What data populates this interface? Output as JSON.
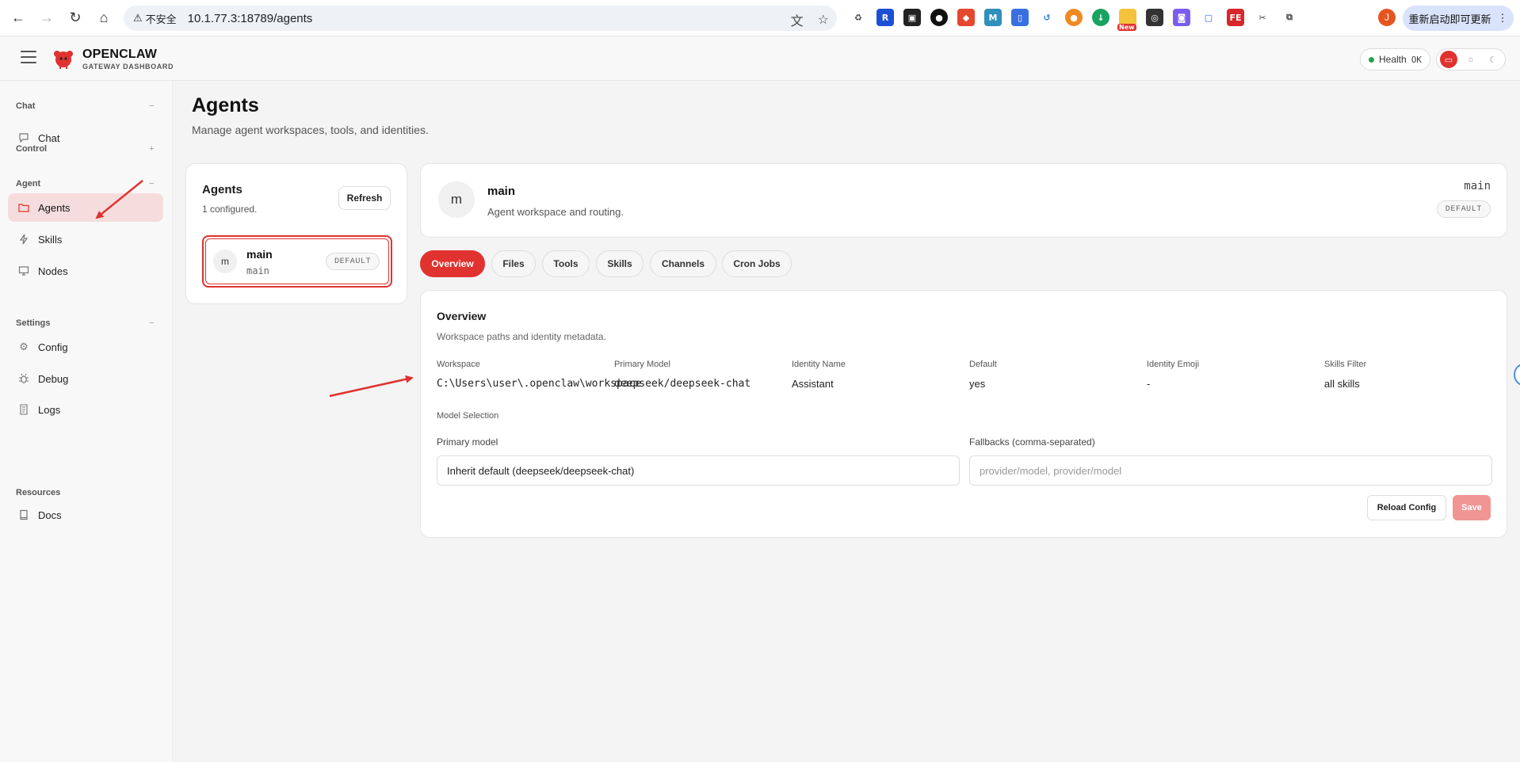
{
  "browser": {
    "insecure_label": "不安全",
    "url": "10.1.77.3:18789/agents",
    "extension_new_badge": "New",
    "profile_initial": "J",
    "update_button": "重新启动即可更新"
  },
  "header": {
    "brand": "OPENCLAW",
    "brand_sub": "GATEWAY DASHBOARD",
    "health_label": "Health",
    "health_value": "OK"
  },
  "sidebar": {
    "groups": [
      {
        "title": "Chat",
        "toggle": "−"
      },
      {
        "title": "Control",
        "toggle": "+"
      },
      {
        "title": "Agent",
        "toggle": "−"
      },
      {
        "title": "Settings",
        "toggle": "−"
      },
      {
        "title": "Resources",
        "toggle": ""
      }
    ],
    "items": [
      {
        "label": "Chat",
        "icon": "chat-bubble-icon"
      },
      {
        "label": "Agents",
        "icon": "folder-icon",
        "active": true
      },
      {
        "label": "Skills",
        "icon": "bolt-icon"
      },
      {
        "label": "Nodes",
        "icon": "monitor-icon"
      },
      {
        "label": "Config",
        "icon": "gear-icon"
      },
      {
        "label": "Debug",
        "icon": "bug-icon"
      },
      {
        "label": "Logs",
        "icon": "scroll-icon"
      },
      {
        "label": "Docs",
        "icon": "book-icon"
      }
    ]
  },
  "page": {
    "title": "Agents",
    "subtitle": "Manage agent workspaces, tools, and identities."
  },
  "agents_panel": {
    "title": "Agents",
    "count": "1 configured.",
    "refresh": "Refresh",
    "list": [
      {
        "initial": "m",
        "name": "main",
        "id": "main",
        "badge": "DEFAULT"
      }
    ]
  },
  "detail": {
    "initial": "m",
    "name": "main",
    "subtitle": "Agent workspace and routing.",
    "id": "main",
    "badge": "DEFAULT"
  },
  "tabs": [
    "Overview",
    "Files",
    "Tools",
    "Skills",
    "Channels",
    "Cron Jobs"
  ],
  "overview": {
    "title": "Overview",
    "subtitle": "Workspace paths and identity metadata.",
    "meta": [
      {
        "label": "Workspace",
        "value": "C:\\Users\\user\\.openclaw\\workspace"
      },
      {
        "label": "Primary Model",
        "value": "deepseek/deepseek-chat"
      },
      {
        "label": "Identity Name",
        "value": "Assistant"
      },
      {
        "label": "Default",
        "value": "yes"
      },
      {
        "label": "Identity Emoji",
        "value": "-"
      },
      {
        "label": "Skills Filter",
        "value": "all skills"
      }
    ],
    "model_selection_label": "Model Selection",
    "primary_model_label": "Primary model",
    "primary_model_value": "Inherit default (deepseek/deepseek-chat)",
    "fallbacks_label": "Fallbacks (comma-separated)",
    "fallbacks_placeholder": "provider/model, provider/model",
    "reload_button": "Reload Config",
    "save_button": "Save"
  },
  "colors": {
    "accent": "#e0322f",
    "active_nav_bg": "#f6dddd",
    "annotation_arrow": "#e0322f"
  }
}
